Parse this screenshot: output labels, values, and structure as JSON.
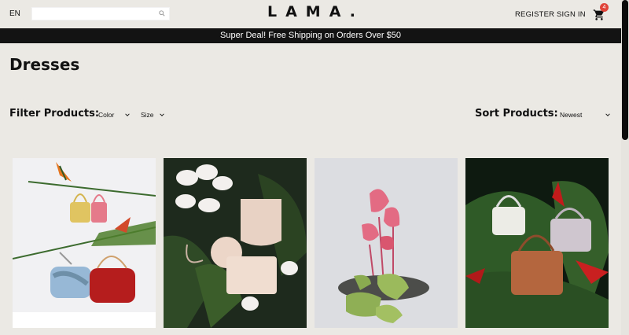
{
  "navbar": {
    "language": "EN",
    "search": {
      "value": "",
      "icon": "search-icon"
    },
    "logo": "LAMA.",
    "register_label": "REGISTER",
    "signin_label": "SIGN IN",
    "cart": {
      "icon": "cart-icon",
      "count": "4",
      "badge_color": "#e0453a"
    }
  },
  "announcement": "Super Deal! Free Shipping on Orders Over $50",
  "page": {
    "title": "Dresses"
  },
  "filters": {
    "label": "Filter Products:",
    "color": {
      "selected": "Color"
    },
    "size": {
      "selected": "Size"
    }
  },
  "sort": {
    "label": "Sort Products:",
    "selected": "Newest"
  },
  "products": [
    {
      "image": "bags-hanging-on-branch-photo"
    },
    {
      "image": "bags-with-orchids-on-leaves-photo"
    },
    {
      "image": "sandals-with-pink-anthurium-photo"
    },
    {
      "image": "bags-with-red-flowers-on-ferns-photo"
    }
  ],
  "colors": {
    "announcement_bg": "#131313",
    "page_bg": "#ebe9e4"
  }
}
